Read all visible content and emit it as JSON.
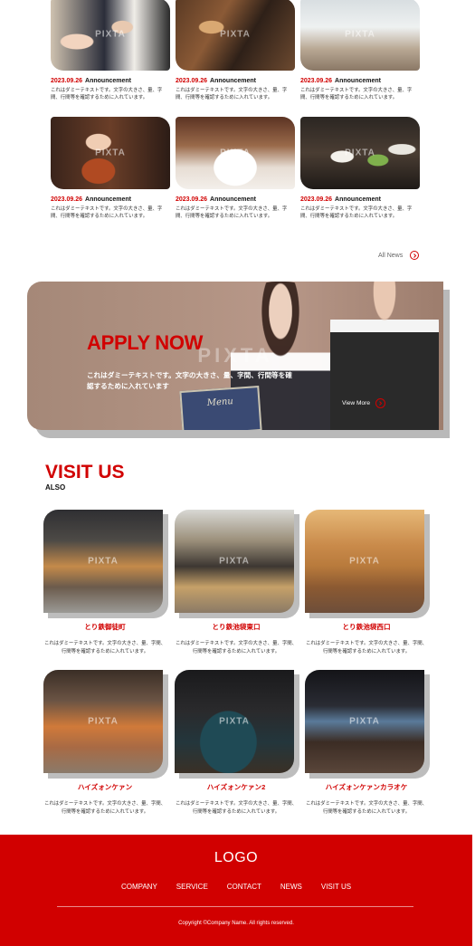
{
  "news": {
    "items": [
      {
        "date": "2023.09.26",
        "category": "Announcement",
        "text": "これはダミーテキストです。文字の大きさ、量、字間、行間等を確認するために入れています。"
      },
      {
        "date": "2023.09.26",
        "category": "Announcement",
        "text": "これはダミーテキストです。文字の大きさ、量、字間、行間等を確認するために入れています。"
      },
      {
        "date": "2023.09.26",
        "category": "Announcement",
        "text": "これはダミーテキストです。文字の大きさ、量、字間、行間等を確認するために入れています。"
      },
      {
        "date": "2023.09.26",
        "category": "Announcement",
        "text": "これはダミーテキストです。文字の大きさ、量、字間、行間等を確認するために入れています。"
      },
      {
        "date": "2023.09.26",
        "category": "Announcement",
        "text": "これはダミーテキストです。文字の大きさ、量、字間、行間等を確認するために入れています。"
      },
      {
        "date": "2023.09.26",
        "category": "Announcement",
        "text": "これはダミーテキストです。文字の大きさ、量、字間、行間等を確認するために入れています。"
      }
    ],
    "all_news_label": "All News"
  },
  "watermark": "PIXTA",
  "apply": {
    "title": "APPLY NOW",
    "text": "これはダミーテキストです。文字の大きさ、量、字間、行間等を確認するために入れています",
    "view_more": "View More",
    "menu_label": "Menu"
  },
  "visit": {
    "title": "VISIT US",
    "subtitle": "ALSO",
    "stores": [
      {
        "name": "とり鉄御徒町",
        "text": "これはダミーテキストです。文字の大きさ、量、字間、行間等を確認するために入れています。"
      },
      {
        "name": "とり鉄池袋東口",
        "text": "これはダミーテキストです。文字の大きさ、量、字間、行間等を確認するために入れています。"
      },
      {
        "name": "とり鉄池袋西口",
        "text": "これはダミーテキストです。文字の大きさ、量、字間、行間等を確認するために入れています。"
      },
      {
        "name": "ハイズォンケァン",
        "text": "これはダミーテキストです。文字の大きさ、量、字間、行間等を確認するために入れています。"
      },
      {
        "name": "ハイズォンケァン2",
        "text": "これはダミーテキストです。文字の大きさ、量、字間、行間等を確認するために入れています。"
      },
      {
        "name": "ハイズォンケァンカラオケ",
        "text": "これはダミーテキストです。文字の大きさ、量、字間、行間等を確認するために入れています。"
      }
    ]
  },
  "footer": {
    "logo": "LOGO",
    "nav": [
      "COMPANY",
      "SERVICE",
      "CONTACT",
      "NEWS",
      "VISIT US"
    ],
    "copyright": "Copyright ©Company Name. All rights reserved."
  },
  "colors": {
    "accent": "#d10000",
    "banner": "#b09080",
    "footer": "#d10000"
  }
}
